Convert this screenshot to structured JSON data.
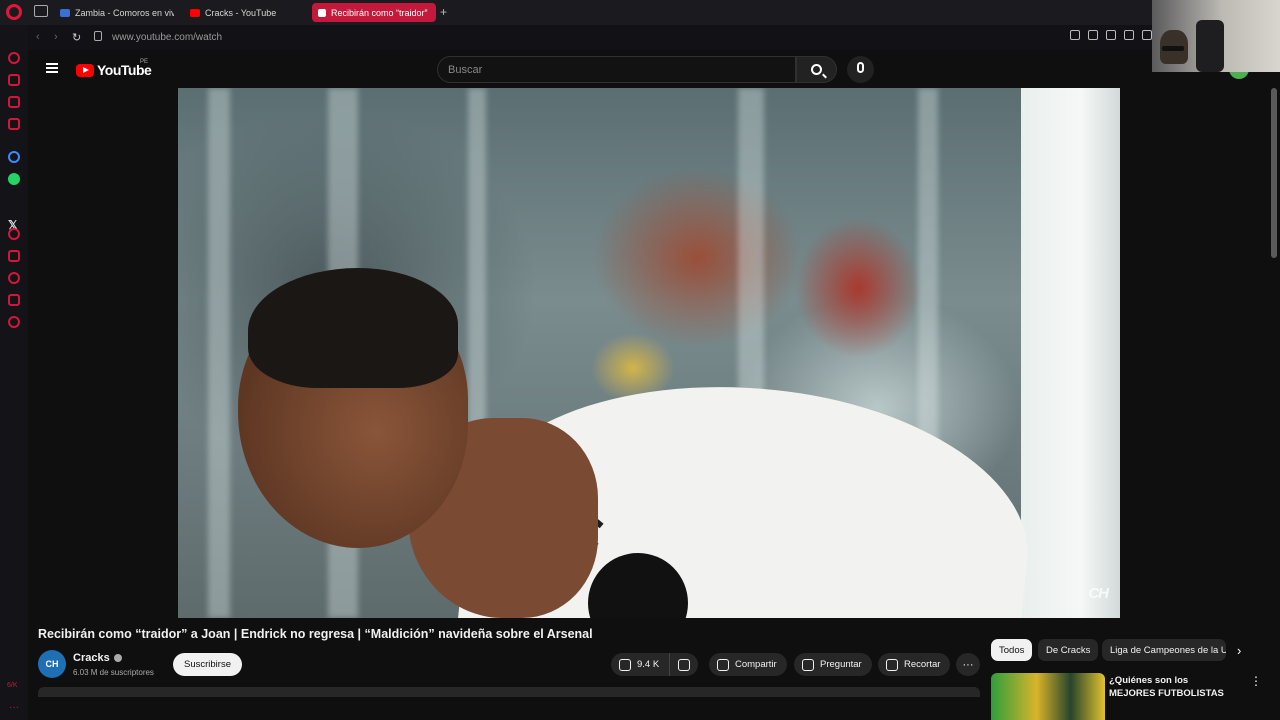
{
  "browser": {
    "tabs": [
      {
        "label": "Zambia - Comoros en vivo",
        "active": false
      },
      {
        "label": "Cracks - YouTube",
        "active": false
      },
      {
        "label": "Recibirán como “traidor”",
        "active": true
      }
    ],
    "address": "www.youtube.com/watch",
    "accent_color": "#c4193c"
  },
  "masthead": {
    "logo_text": "YouTube",
    "region": "PE",
    "search_placeholder": "Buscar"
  },
  "player": {
    "watermark": "CH"
  },
  "video": {
    "title": "Recibirán como “traidor” a Joan | Endrick no regresa | “Maldición” navideña sobre el Arsenal",
    "channel_initials": "CH",
    "channel_name": "Cracks",
    "subscribers": "6.03 M de suscriptores",
    "subscribe_label": "Suscribirse",
    "likes": "9.4 K",
    "share_label": "Compartir",
    "ask_label": "Preguntar",
    "clip_label": "Recortar",
    "more_label": "···"
  },
  "related": {
    "chips": [
      "Todos",
      "De Cracks",
      "Liga de Campeones de la U"
    ],
    "first_title": "¿Quiénes son los MEJORES FUTBOLISTAS BRASILEÑOS d"
  },
  "sidebar": {
    "bottom_label": "6/K"
  }
}
